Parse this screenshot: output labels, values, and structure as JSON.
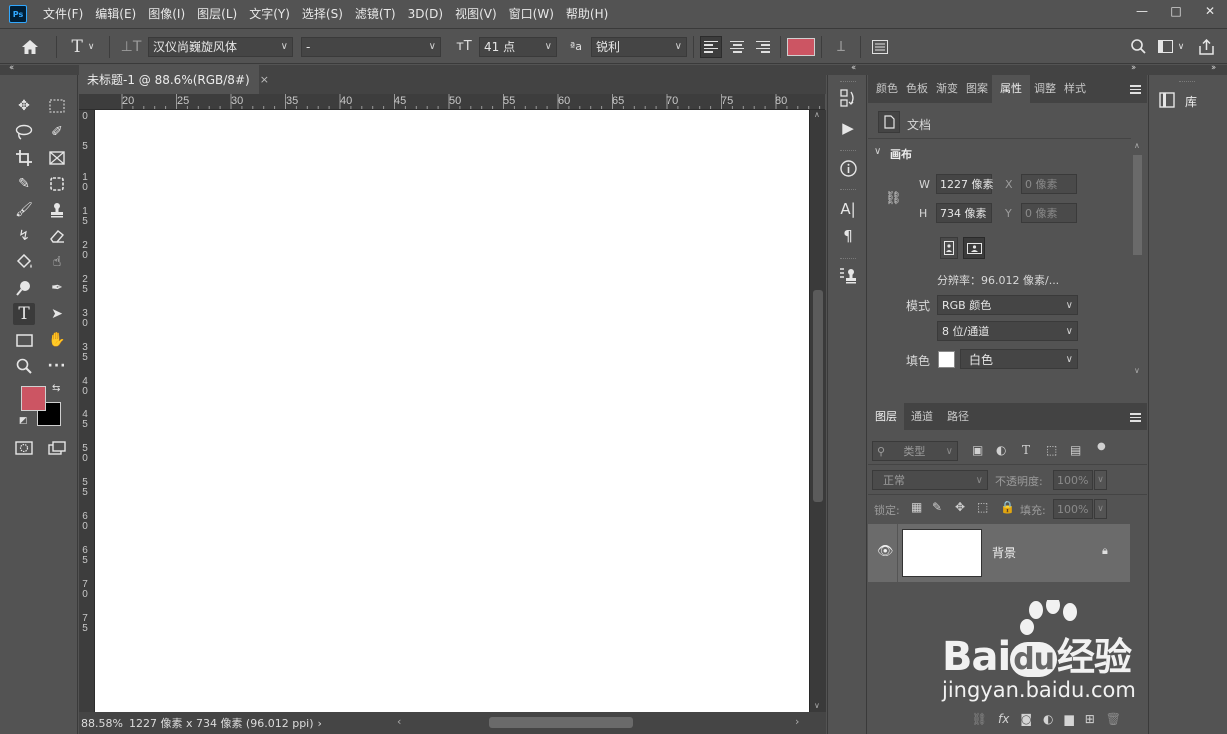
{
  "app": {
    "logo_text": "Ps"
  },
  "menubar": {
    "items": [
      "文件(F)",
      "编辑(E)",
      "图像(I)",
      "图层(L)",
      "文字(Y)",
      "选择(S)",
      "滤镜(T)",
      "3D(D)",
      "视图(V)",
      "窗口(W)",
      "帮助(H)"
    ]
  },
  "window_controls": {
    "minimize": "—",
    "restore": "□",
    "close": "✕"
  },
  "options": {
    "font_family": "汉仪尚巍旋风体",
    "font_style": "-",
    "font_size": "41 点",
    "antialias_label": "ªa",
    "antialias": "锐利",
    "text_color": "#cc5563"
  },
  "document": {
    "tab_title": "未标题-1 @ 88.6%(RGB/8#)",
    "close_glyph": "×"
  },
  "ruler": {
    "top_labels": [
      "20",
      "25",
      "30",
      "35",
      "40",
      "45",
      "50",
      "55",
      "60",
      "65",
      "70",
      "75",
      "80"
    ],
    "left_labels": [
      "0",
      "5",
      "1\n0",
      "1\n5",
      "2\n0",
      "2\n5",
      "3\n0",
      "3\n5",
      "4\n0",
      "4\n5",
      "5\n0",
      "5\n5",
      "6\n0",
      "6\n5",
      "7\n0",
      "7\n5"
    ]
  },
  "status": {
    "zoom": "88.58%",
    "info": "1227 像素 x 734 像素 (96.012 ppi)",
    "arrow": "›"
  },
  "colors": {
    "foreground": "#cc5563",
    "background": "#000000",
    "canvas": "#ffffff"
  },
  "properties": {
    "tabs": [
      "颜色",
      "色板",
      "渐变",
      "图案",
      "属性",
      "调整",
      "样式"
    ],
    "active_tab": "属性",
    "doc_label": "文档",
    "section": "画布",
    "w_label": "W",
    "w_value": "1227 像素",
    "h_label": "H",
    "h_value": "734 像素",
    "x_label": "X",
    "x_value": "0 像素",
    "y_label": "Y",
    "y_value": "0 像素",
    "resolution": "分辨率：96.012 像素/...",
    "mode_label": "模式",
    "mode_value": "RGB 颜色",
    "depth_value": "8 位/通道",
    "fill_label": "填色",
    "fill_value": "白色"
  },
  "layers": {
    "tabs": [
      "图层",
      "通道",
      "路径"
    ],
    "active_tab": "图层",
    "filter_placeholder": "类型",
    "blend_mode": "正常",
    "opacity_label": "不透明度:",
    "opacity_value": "100%",
    "lock_label": "锁定:",
    "fill_label": "填充:",
    "fill_value": "100%",
    "items": [
      {
        "name": "背景",
        "visible": true,
        "locked": true
      }
    ]
  },
  "library": {
    "label": "库"
  },
  "watermark": {
    "brand": "Bai",
    "brand2": "du",
    "cn": "经验",
    "url": "jingyan.baidu.com"
  }
}
